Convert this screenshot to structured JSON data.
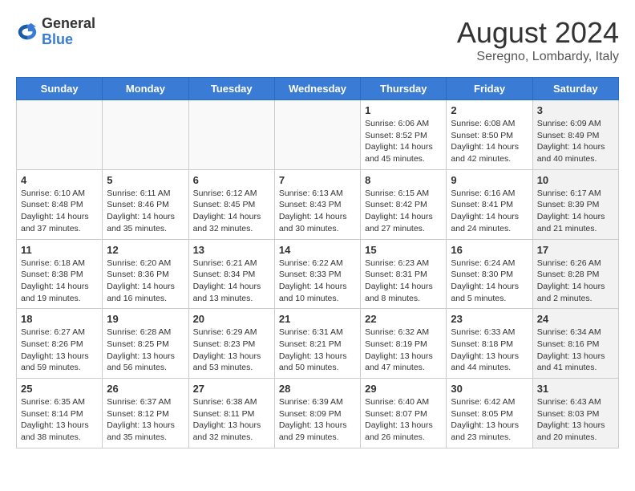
{
  "header": {
    "logo_general": "General",
    "logo_blue": "Blue",
    "month_year": "August 2024",
    "location": "Seregno, Lombardy, Italy"
  },
  "days_of_week": [
    "Sunday",
    "Monday",
    "Tuesday",
    "Wednesday",
    "Thursday",
    "Friday",
    "Saturday"
  ],
  "weeks": [
    [
      {
        "day": "",
        "info": "",
        "shaded": false
      },
      {
        "day": "",
        "info": "",
        "shaded": false
      },
      {
        "day": "",
        "info": "",
        "shaded": false
      },
      {
        "day": "",
        "info": "",
        "shaded": false
      },
      {
        "day": "1",
        "info": "Sunrise: 6:06 AM\nSunset: 8:52 PM\nDaylight: 14 hours\nand 45 minutes.",
        "shaded": false
      },
      {
        "day": "2",
        "info": "Sunrise: 6:08 AM\nSunset: 8:50 PM\nDaylight: 14 hours\nand 42 minutes.",
        "shaded": false
      },
      {
        "day": "3",
        "info": "Sunrise: 6:09 AM\nSunset: 8:49 PM\nDaylight: 14 hours\nand 40 minutes.",
        "shaded": true
      }
    ],
    [
      {
        "day": "4",
        "info": "Sunrise: 6:10 AM\nSunset: 8:48 PM\nDaylight: 14 hours\nand 37 minutes.",
        "shaded": false
      },
      {
        "day": "5",
        "info": "Sunrise: 6:11 AM\nSunset: 8:46 PM\nDaylight: 14 hours\nand 35 minutes.",
        "shaded": false
      },
      {
        "day": "6",
        "info": "Sunrise: 6:12 AM\nSunset: 8:45 PM\nDaylight: 14 hours\nand 32 minutes.",
        "shaded": false
      },
      {
        "day": "7",
        "info": "Sunrise: 6:13 AM\nSunset: 8:43 PM\nDaylight: 14 hours\nand 30 minutes.",
        "shaded": false
      },
      {
        "day": "8",
        "info": "Sunrise: 6:15 AM\nSunset: 8:42 PM\nDaylight: 14 hours\nand 27 minutes.",
        "shaded": false
      },
      {
        "day": "9",
        "info": "Sunrise: 6:16 AM\nSunset: 8:41 PM\nDaylight: 14 hours\nand 24 minutes.",
        "shaded": false
      },
      {
        "day": "10",
        "info": "Sunrise: 6:17 AM\nSunset: 8:39 PM\nDaylight: 14 hours\nand 21 minutes.",
        "shaded": true
      }
    ],
    [
      {
        "day": "11",
        "info": "Sunrise: 6:18 AM\nSunset: 8:38 PM\nDaylight: 14 hours\nand 19 minutes.",
        "shaded": false
      },
      {
        "day": "12",
        "info": "Sunrise: 6:20 AM\nSunset: 8:36 PM\nDaylight: 14 hours\nand 16 minutes.",
        "shaded": false
      },
      {
        "day": "13",
        "info": "Sunrise: 6:21 AM\nSunset: 8:34 PM\nDaylight: 14 hours\nand 13 minutes.",
        "shaded": false
      },
      {
        "day": "14",
        "info": "Sunrise: 6:22 AM\nSunset: 8:33 PM\nDaylight: 14 hours\nand 10 minutes.",
        "shaded": false
      },
      {
        "day": "15",
        "info": "Sunrise: 6:23 AM\nSunset: 8:31 PM\nDaylight: 14 hours\nand 8 minutes.",
        "shaded": false
      },
      {
        "day": "16",
        "info": "Sunrise: 6:24 AM\nSunset: 8:30 PM\nDaylight: 14 hours\nand 5 minutes.",
        "shaded": false
      },
      {
        "day": "17",
        "info": "Sunrise: 6:26 AM\nSunset: 8:28 PM\nDaylight: 14 hours\nand 2 minutes.",
        "shaded": true
      }
    ],
    [
      {
        "day": "18",
        "info": "Sunrise: 6:27 AM\nSunset: 8:26 PM\nDaylight: 13 hours\nand 59 minutes.",
        "shaded": false
      },
      {
        "day": "19",
        "info": "Sunrise: 6:28 AM\nSunset: 8:25 PM\nDaylight: 13 hours\nand 56 minutes.",
        "shaded": false
      },
      {
        "day": "20",
        "info": "Sunrise: 6:29 AM\nSunset: 8:23 PM\nDaylight: 13 hours\nand 53 minutes.",
        "shaded": false
      },
      {
        "day": "21",
        "info": "Sunrise: 6:31 AM\nSunset: 8:21 PM\nDaylight: 13 hours\nand 50 minutes.",
        "shaded": false
      },
      {
        "day": "22",
        "info": "Sunrise: 6:32 AM\nSunset: 8:19 PM\nDaylight: 13 hours\nand 47 minutes.",
        "shaded": false
      },
      {
        "day": "23",
        "info": "Sunrise: 6:33 AM\nSunset: 8:18 PM\nDaylight: 13 hours\nand 44 minutes.",
        "shaded": false
      },
      {
        "day": "24",
        "info": "Sunrise: 6:34 AM\nSunset: 8:16 PM\nDaylight: 13 hours\nand 41 minutes.",
        "shaded": true
      }
    ],
    [
      {
        "day": "25",
        "info": "Sunrise: 6:35 AM\nSunset: 8:14 PM\nDaylight: 13 hours\nand 38 minutes.",
        "shaded": false
      },
      {
        "day": "26",
        "info": "Sunrise: 6:37 AM\nSunset: 8:12 PM\nDaylight: 13 hours\nand 35 minutes.",
        "shaded": false
      },
      {
        "day": "27",
        "info": "Sunrise: 6:38 AM\nSunset: 8:11 PM\nDaylight: 13 hours\nand 32 minutes.",
        "shaded": false
      },
      {
        "day": "28",
        "info": "Sunrise: 6:39 AM\nSunset: 8:09 PM\nDaylight: 13 hours\nand 29 minutes.",
        "shaded": false
      },
      {
        "day": "29",
        "info": "Sunrise: 6:40 AM\nSunset: 8:07 PM\nDaylight: 13 hours\nand 26 minutes.",
        "shaded": false
      },
      {
        "day": "30",
        "info": "Sunrise: 6:42 AM\nSunset: 8:05 PM\nDaylight: 13 hours\nand 23 minutes.",
        "shaded": false
      },
      {
        "day": "31",
        "info": "Sunrise: 6:43 AM\nSunset: 8:03 PM\nDaylight: 13 hours\nand 20 minutes.",
        "shaded": true
      }
    ]
  ]
}
